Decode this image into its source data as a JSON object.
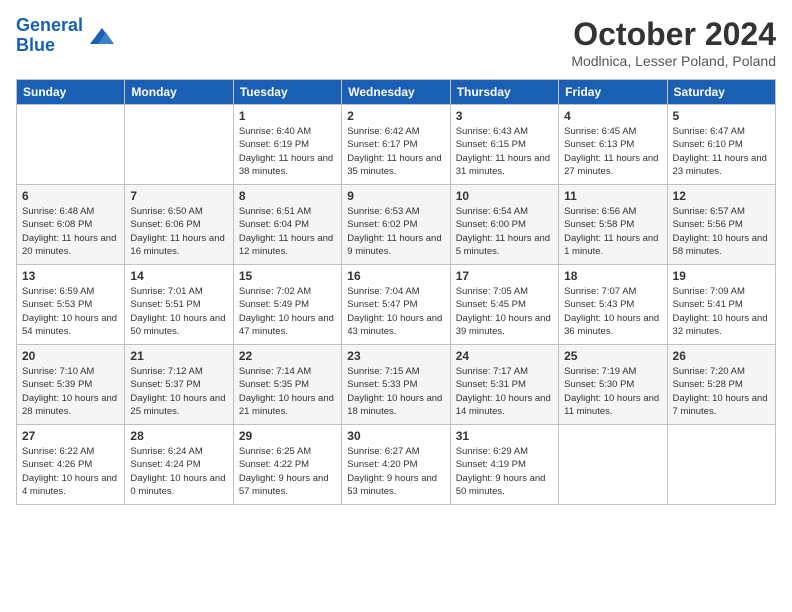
{
  "logo": {
    "line1": "General",
    "line2": "Blue"
  },
  "title": "October 2024",
  "location": "Modlnica, Lesser Poland, Poland",
  "headers": [
    "Sunday",
    "Monday",
    "Tuesday",
    "Wednesday",
    "Thursday",
    "Friday",
    "Saturday"
  ],
  "weeks": [
    [
      {
        "day": "",
        "text": ""
      },
      {
        "day": "",
        "text": ""
      },
      {
        "day": "1",
        "text": "Sunrise: 6:40 AM\nSunset: 6:19 PM\nDaylight: 11 hours and 38 minutes."
      },
      {
        "day": "2",
        "text": "Sunrise: 6:42 AM\nSunset: 6:17 PM\nDaylight: 11 hours and 35 minutes."
      },
      {
        "day": "3",
        "text": "Sunrise: 6:43 AM\nSunset: 6:15 PM\nDaylight: 11 hours and 31 minutes."
      },
      {
        "day": "4",
        "text": "Sunrise: 6:45 AM\nSunset: 6:13 PM\nDaylight: 11 hours and 27 minutes."
      },
      {
        "day": "5",
        "text": "Sunrise: 6:47 AM\nSunset: 6:10 PM\nDaylight: 11 hours and 23 minutes."
      }
    ],
    [
      {
        "day": "6",
        "text": "Sunrise: 6:48 AM\nSunset: 6:08 PM\nDaylight: 11 hours and 20 minutes."
      },
      {
        "day": "7",
        "text": "Sunrise: 6:50 AM\nSunset: 6:06 PM\nDaylight: 11 hours and 16 minutes."
      },
      {
        "day": "8",
        "text": "Sunrise: 6:51 AM\nSunset: 6:04 PM\nDaylight: 11 hours and 12 minutes."
      },
      {
        "day": "9",
        "text": "Sunrise: 6:53 AM\nSunset: 6:02 PM\nDaylight: 11 hours and 9 minutes."
      },
      {
        "day": "10",
        "text": "Sunrise: 6:54 AM\nSunset: 6:00 PM\nDaylight: 11 hours and 5 minutes."
      },
      {
        "day": "11",
        "text": "Sunrise: 6:56 AM\nSunset: 5:58 PM\nDaylight: 11 hours and 1 minute."
      },
      {
        "day": "12",
        "text": "Sunrise: 6:57 AM\nSunset: 5:56 PM\nDaylight: 10 hours and 58 minutes."
      }
    ],
    [
      {
        "day": "13",
        "text": "Sunrise: 6:59 AM\nSunset: 5:53 PM\nDaylight: 10 hours and 54 minutes."
      },
      {
        "day": "14",
        "text": "Sunrise: 7:01 AM\nSunset: 5:51 PM\nDaylight: 10 hours and 50 minutes."
      },
      {
        "day": "15",
        "text": "Sunrise: 7:02 AM\nSunset: 5:49 PM\nDaylight: 10 hours and 47 minutes."
      },
      {
        "day": "16",
        "text": "Sunrise: 7:04 AM\nSunset: 5:47 PM\nDaylight: 10 hours and 43 minutes."
      },
      {
        "day": "17",
        "text": "Sunrise: 7:05 AM\nSunset: 5:45 PM\nDaylight: 10 hours and 39 minutes."
      },
      {
        "day": "18",
        "text": "Sunrise: 7:07 AM\nSunset: 5:43 PM\nDaylight: 10 hours and 36 minutes."
      },
      {
        "day": "19",
        "text": "Sunrise: 7:09 AM\nSunset: 5:41 PM\nDaylight: 10 hours and 32 minutes."
      }
    ],
    [
      {
        "day": "20",
        "text": "Sunrise: 7:10 AM\nSunset: 5:39 PM\nDaylight: 10 hours and 28 minutes."
      },
      {
        "day": "21",
        "text": "Sunrise: 7:12 AM\nSunset: 5:37 PM\nDaylight: 10 hours and 25 minutes."
      },
      {
        "day": "22",
        "text": "Sunrise: 7:14 AM\nSunset: 5:35 PM\nDaylight: 10 hours and 21 minutes."
      },
      {
        "day": "23",
        "text": "Sunrise: 7:15 AM\nSunset: 5:33 PM\nDaylight: 10 hours and 18 minutes."
      },
      {
        "day": "24",
        "text": "Sunrise: 7:17 AM\nSunset: 5:31 PM\nDaylight: 10 hours and 14 minutes."
      },
      {
        "day": "25",
        "text": "Sunrise: 7:19 AM\nSunset: 5:30 PM\nDaylight: 10 hours and 11 minutes."
      },
      {
        "day": "26",
        "text": "Sunrise: 7:20 AM\nSunset: 5:28 PM\nDaylight: 10 hours and 7 minutes."
      }
    ],
    [
      {
        "day": "27",
        "text": "Sunrise: 6:22 AM\nSunset: 4:26 PM\nDaylight: 10 hours and 4 minutes."
      },
      {
        "day": "28",
        "text": "Sunrise: 6:24 AM\nSunset: 4:24 PM\nDaylight: 10 hours and 0 minutes."
      },
      {
        "day": "29",
        "text": "Sunrise: 6:25 AM\nSunset: 4:22 PM\nDaylight: 9 hours and 57 minutes."
      },
      {
        "day": "30",
        "text": "Sunrise: 6:27 AM\nSunset: 4:20 PM\nDaylight: 9 hours and 53 minutes."
      },
      {
        "day": "31",
        "text": "Sunrise: 6:29 AM\nSunset: 4:19 PM\nDaylight: 9 hours and 50 minutes."
      },
      {
        "day": "",
        "text": ""
      },
      {
        "day": "",
        "text": ""
      }
    ]
  ]
}
